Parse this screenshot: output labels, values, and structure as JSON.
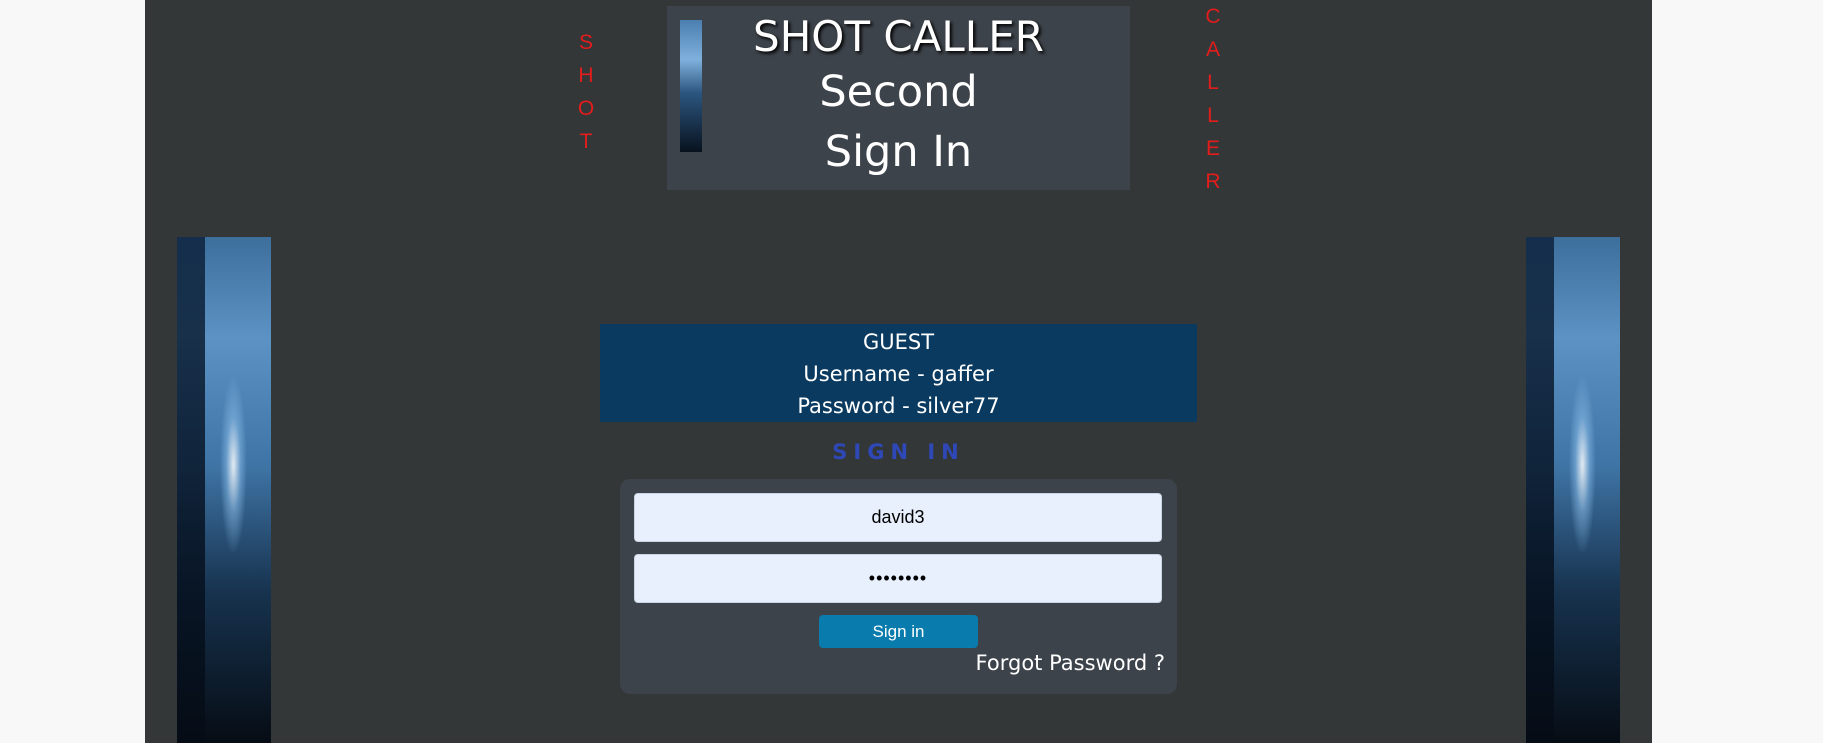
{
  "side_text": {
    "left_letters": [
      "S",
      "H",
      "O",
      "T"
    ],
    "right_letters": [
      "C",
      "A",
      "L",
      "L",
      "E",
      "R"
    ]
  },
  "header": {
    "title": "SHOT CALLER",
    "subtitle": "Second",
    "page": "Sign In"
  },
  "guest": {
    "heading": "GUEST",
    "username_line": "Username - gaffer",
    "password_line": "Password - silver77"
  },
  "signin": {
    "title": "SIGN IN",
    "username_value": "david3",
    "password_value": "••••••••",
    "button_label": "Sign in",
    "forgot_label": "Forgot Password ?"
  },
  "colors": {
    "panel": "#333738",
    "accent_red": "#e31c1c",
    "guest_bg": "#0a3a60",
    "button": "#0a7bad",
    "signin_title": "#2f48b8"
  }
}
